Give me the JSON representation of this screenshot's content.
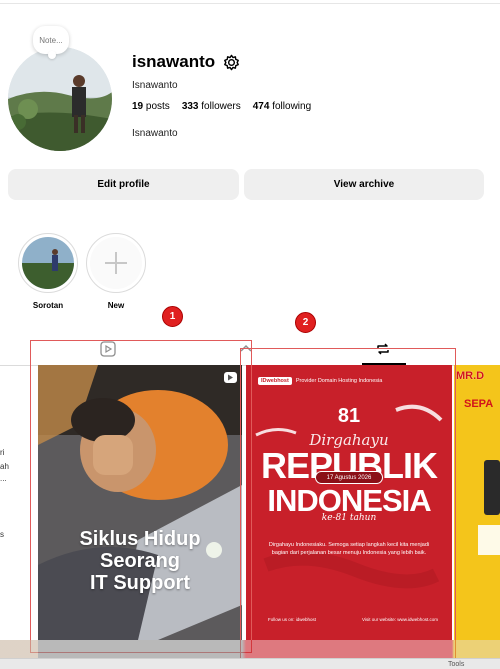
{
  "profile": {
    "note": "Note...",
    "username": "isnawanto",
    "full_name": "Isnawanto",
    "bio": "Isnawanto",
    "stats": {
      "posts_count": "19",
      "posts_label": "posts",
      "followers_count": "333",
      "followers_label": "followers",
      "following_count": "474",
      "following_label": "following"
    }
  },
  "actions": {
    "edit_profile": "Edit profile",
    "view_archive": "View archive"
  },
  "highlights": [
    {
      "label": "Sorotan"
    },
    {
      "label": "New"
    }
  ],
  "annotations": [
    "1",
    "2"
  ],
  "posts": [
    {
      "type": "reel",
      "caption": [
        "Siklus Hidup",
        "Seorang",
        "IT Support"
      ]
    },
    {
      "type": "image",
      "brand": "IDwebhost",
      "tagline": "Provider Domain Hosting Indonesia",
      "number": "81",
      "heading_script": "Dirgahayu",
      "heading_1": "REPUBLIK",
      "date": "17 Agustus 2026",
      "heading_2": "INDONESIA",
      "sub_script": "ke-81 tahun",
      "message": "Dirgahayu Indonesiaku. Semoga setiap langkah kecil kita menjadi bagian dari perjalanan besar menuju Indonesia yang lebih baik.",
      "footer_left": "Follow us on: idwebhost",
      "footer_right": "Visit our website: www.idwebhost.com"
    },
    {
      "type": "image",
      "title": "MR.D",
      "subtitle": "SEPA"
    }
  ],
  "left_fragments": [
    "ri",
    "ah",
    "...",
    "s"
  ],
  "bottom": {
    "tools": "Tools"
  },
  "colors": {
    "button_bg": "#efefef",
    "annotation_red": "#e02020",
    "post2_red": "#c8202a"
  }
}
